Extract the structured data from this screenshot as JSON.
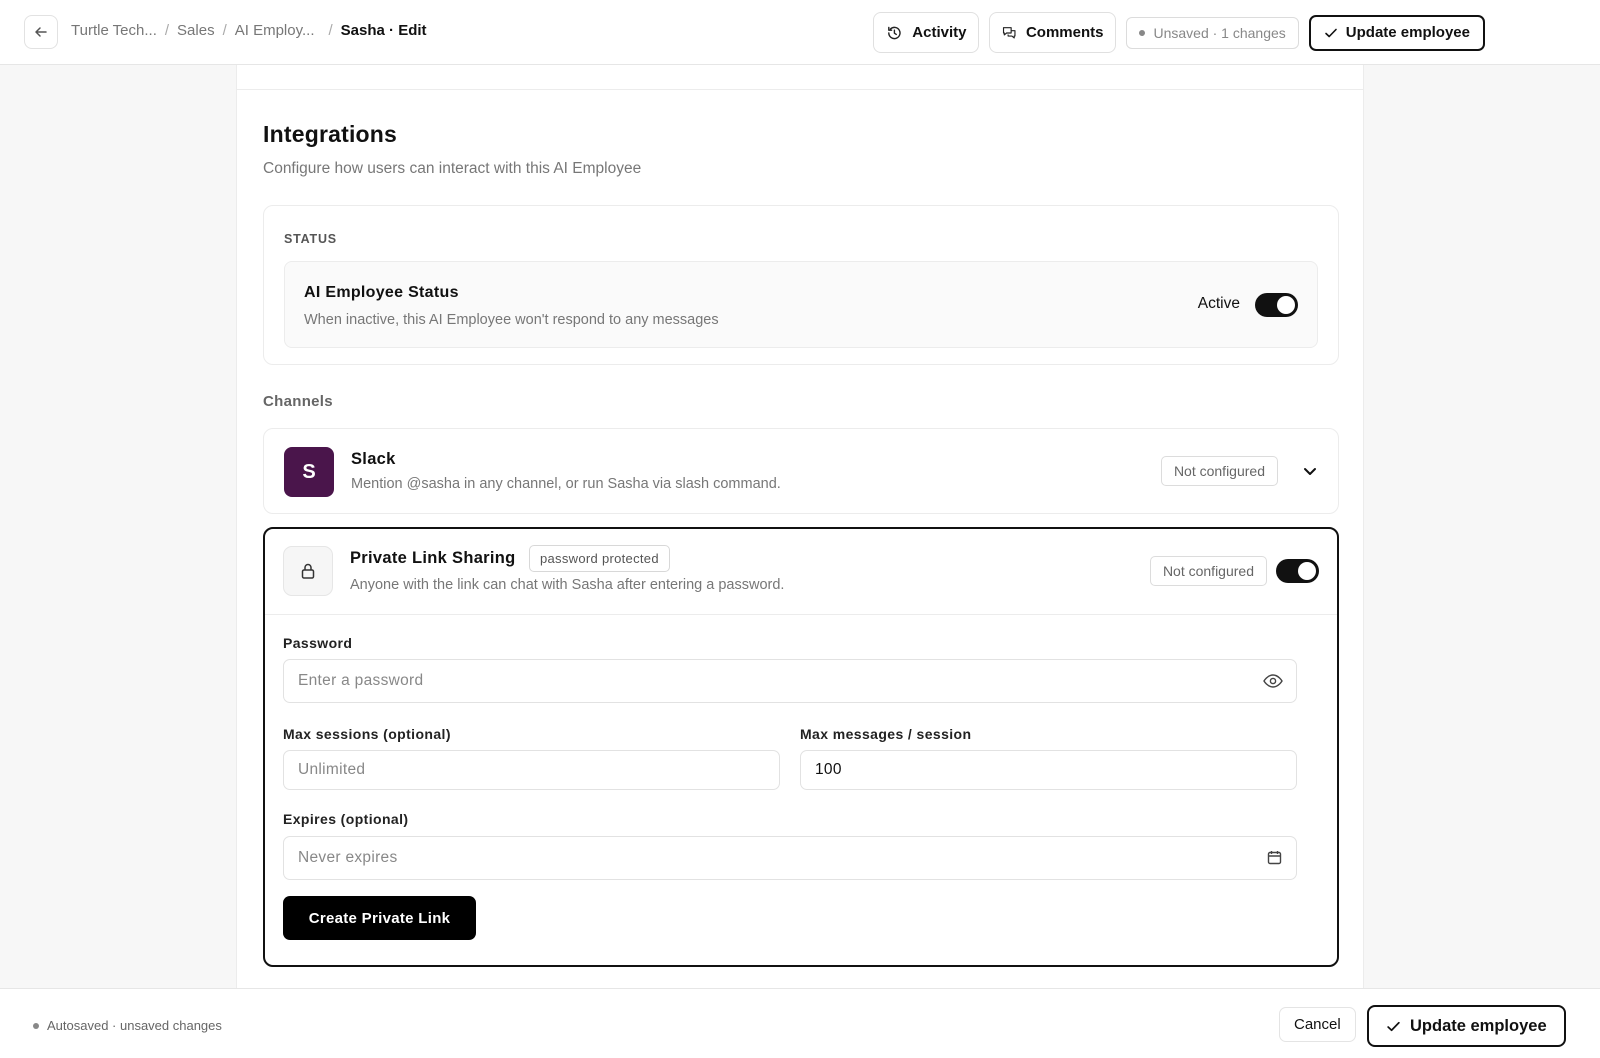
{
  "breadcrumb": {
    "items": [
      "Turtle Tech...",
      "Sales",
      "AI Employ..."
    ],
    "current": "Sasha · Edit"
  },
  "header": {
    "activity_label": "Activity",
    "comments_label": "Comments",
    "unsaved_label": "Unsaved · 1 changes",
    "update_label": "Update employee"
  },
  "integrations": {
    "title": "Integrations",
    "subtitle": "Configure how users can interact with this AI Employee"
  },
  "status": {
    "section_label": "STATUS",
    "title": "AI Employee Status",
    "description": "When inactive, this AI Employee won't respond to any messages",
    "state_label": "Active",
    "enabled": true
  },
  "channels": {
    "label": "Channels",
    "slack": {
      "logo_letter": "S",
      "title": "Slack",
      "description": "Mention @sasha in any channel, or run Sasha via slash command.",
      "status": "Not configured"
    },
    "private_link": {
      "title": "Private Link Sharing",
      "tag": "password protected",
      "description": "Anyone with the link can chat with Sasha after entering a password.",
      "status": "Not configured",
      "enabled": true,
      "password": {
        "label": "Password",
        "placeholder": "Enter a password",
        "value": ""
      },
      "max_sessions": {
        "label": "Max sessions (optional)",
        "placeholder": "Unlimited",
        "value": ""
      },
      "max_messages": {
        "label": "Max messages / session",
        "placeholder": "",
        "value": "100"
      },
      "expires": {
        "label": "Expires (optional)",
        "placeholder": "Never expires",
        "value": ""
      },
      "create_label": "Create Private Link"
    }
  },
  "footer": {
    "autosave_text": "Autosaved · unsaved changes",
    "cancel_label": "Cancel",
    "update_label": "Update employee"
  },
  "colors": {
    "slack_brand": "#4a154b",
    "primary": "#111111",
    "muted_text": "#777777"
  }
}
